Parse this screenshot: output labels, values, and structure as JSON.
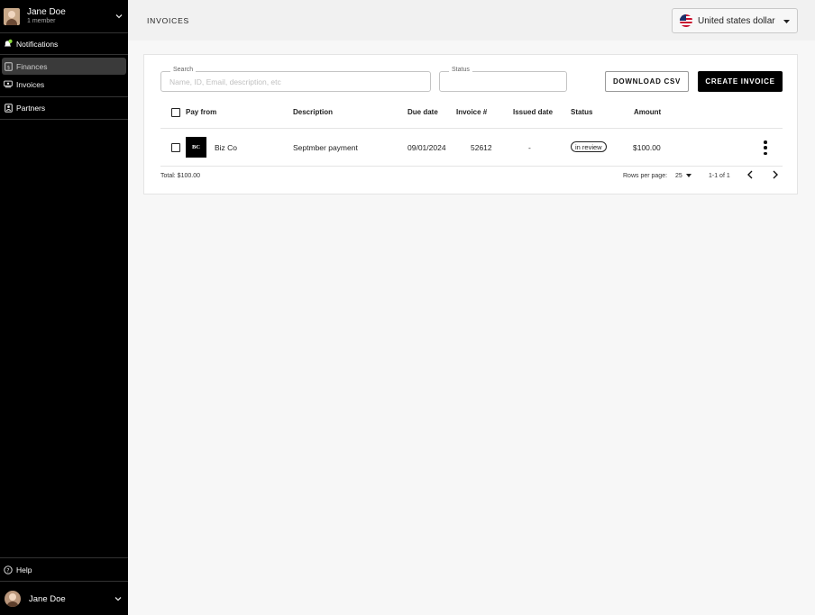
{
  "sidebar": {
    "user_name": "Jane Doe",
    "user_sub": "1 member",
    "notifications_label": "Notifications",
    "items": [
      {
        "label": "Finances",
        "icon": "finances-icon",
        "active": true
      },
      {
        "label": "Invoices",
        "icon": "invoices-icon",
        "active": false
      }
    ],
    "partners_label": "Partners",
    "help_label": "Help",
    "footer_user_name": "Jane Doe"
  },
  "header": {
    "title": "INVOICES",
    "currency_label": "United states dollar"
  },
  "filters": {
    "search_label": "Search",
    "search_placeholder": "Name, ID, Email, description, etc",
    "status_label": "Status",
    "status_value": ""
  },
  "actions": {
    "download_csv": "DOWNLOAD CSV",
    "create_invoice": "CREATE INVOICE"
  },
  "table": {
    "columns": [
      "Pay from",
      "Description",
      "Due date",
      "Invoice #",
      "Issued date",
      "Status",
      "Amount"
    ],
    "rows": [
      {
        "logo_text": "BC",
        "pay_from": "Biz Co",
        "description": "Septmber payment",
        "due_date": "09/01/2024",
        "invoice_no": "52612",
        "issued_date": "-",
        "status": "in review",
        "amount": "$100.00"
      }
    ]
  },
  "footer": {
    "total": "Total: $100.00",
    "rows_per_page_label": "Rows per page:",
    "rows_per_page_value": "25",
    "range": "1-1 of 1"
  },
  "colors": {
    "sidebar_bg": "#000000",
    "accent_notification": "#8bdc3a",
    "primary_button": "#000000"
  }
}
